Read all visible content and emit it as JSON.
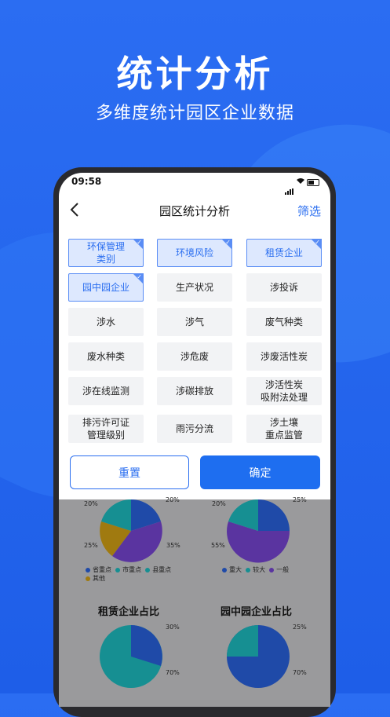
{
  "hero": {
    "title": "统计分析",
    "subtitle": "多维度统计园区企业数据"
  },
  "status_bar": {
    "time": "09:58"
  },
  "nav": {
    "title": "园区统计分析",
    "filter_label": "筛选"
  },
  "filters": [
    {
      "label": "环保管理\n类别",
      "selected": true
    },
    {
      "label": "环境风险",
      "selected": true
    },
    {
      "label": "租赁企业",
      "selected": true
    },
    {
      "label": "园中园企业",
      "selected": true
    },
    {
      "label": "生产状况",
      "selected": false
    },
    {
      "label": "涉投诉",
      "selected": false
    },
    {
      "label": "涉水",
      "selected": false
    },
    {
      "label": "涉气",
      "selected": false
    },
    {
      "label": "废气种类",
      "selected": false
    },
    {
      "label": "废水种类",
      "selected": false
    },
    {
      "label": "涉危废",
      "selected": false
    },
    {
      "label": "涉废活性炭",
      "selected": false
    },
    {
      "label": "涉在线监测",
      "selected": false
    },
    {
      "label": "涉碳排放",
      "selected": false
    },
    {
      "label": "涉活性炭\n吸附法处理",
      "selected": false
    },
    {
      "label": "排污许可证\n管理级别",
      "selected": false
    },
    {
      "label": "雨污分流",
      "selected": false
    },
    {
      "label": "涉土壤\n重点监管",
      "selected": false
    }
  ],
  "buttons": {
    "reset": "重置",
    "confirm": "确定"
  },
  "colors": {
    "accent": "#1e6ef0",
    "selected_bg": "#dde8fe"
  },
  "charts": {
    "pie1": {
      "labels": [
        "20%",
        "20%",
        "35%",
        "25%"
      ],
      "legend": [
        "省重点",
        "市重点",
        "县重点",
        "其他"
      ]
    },
    "pie2": {
      "labels": [
        "20%",
        "25%",
        "55%"
      ],
      "legend": [
        "重大",
        "较大",
        "一般"
      ]
    },
    "pie3": {
      "title": "租赁企业占比",
      "labels": [
        "30%",
        "70%"
      ]
    },
    "pie4": {
      "title": "园中园企业占比",
      "labels": [
        "25%",
        "70%"
      ]
    }
  },
  "chart_data": [
    {
      "type": "pie",
      "categories": [
        "省重点",
        "市重点",
        "县重点",
        "其他"
      ],
      "values": [
        20,
        20,
        35,
        25
      ]
    },
    {
      "type": "pie",
      "categories": [
        "重大",
        "较大",
        "一般"
      ],
      "values": [
        25,
        20,
        55
      ]
    },
    {
      "type": "pie",
      "title": "租赁企业占比",
      "values": [
        30,
        70
      ]
    },
    {
      "type": "pie",
      "title": "园中园企业占比",
      "values": [
        25,
        70
      ]
    }
  ]
}
